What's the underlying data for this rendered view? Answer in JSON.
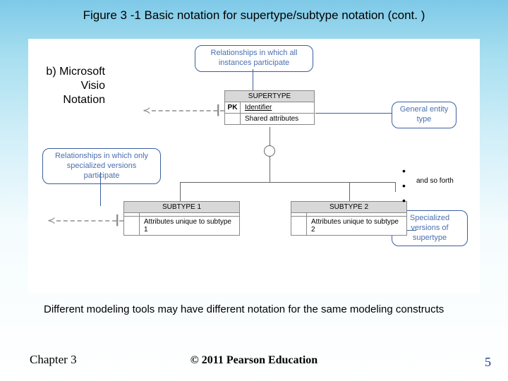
{
  "title": "Figure 3 -1 Basic notation for supertype/subtype notation (cont. )",
  "section_label": "b) Microsoft Visio Notation",
  "callouts": {
    "top": "Relationships in which all instances participate",
    "left": "Relationships in which only specialized versions participate",
    "right1": "General entity type",
    "right2": "Specialized versions of supertype"
  },
  "supertype": {
    "header": "SUPERTYPE",
    "pk_label": "PK",
    "identifier": "Identifier",
    "shared": "Shared attributes"
  },
  "subtype1": {
    "header": "SUBTYPE 1",
    "attr": "Attributes unique to subtype 1"
  },
  "subtype2": {
    "header": "SUBTYPE 2",
    "attr": "Attributes unique to subtype 2"
  },
  "and_so_forth": "and so forth",
  "note": "Different modeling tools may have different notation for the same modeling constructs",
  "chapter": "Chapter 3",
  "copyright": "© 2011 Pearson Education",
  "page": "5"
}
